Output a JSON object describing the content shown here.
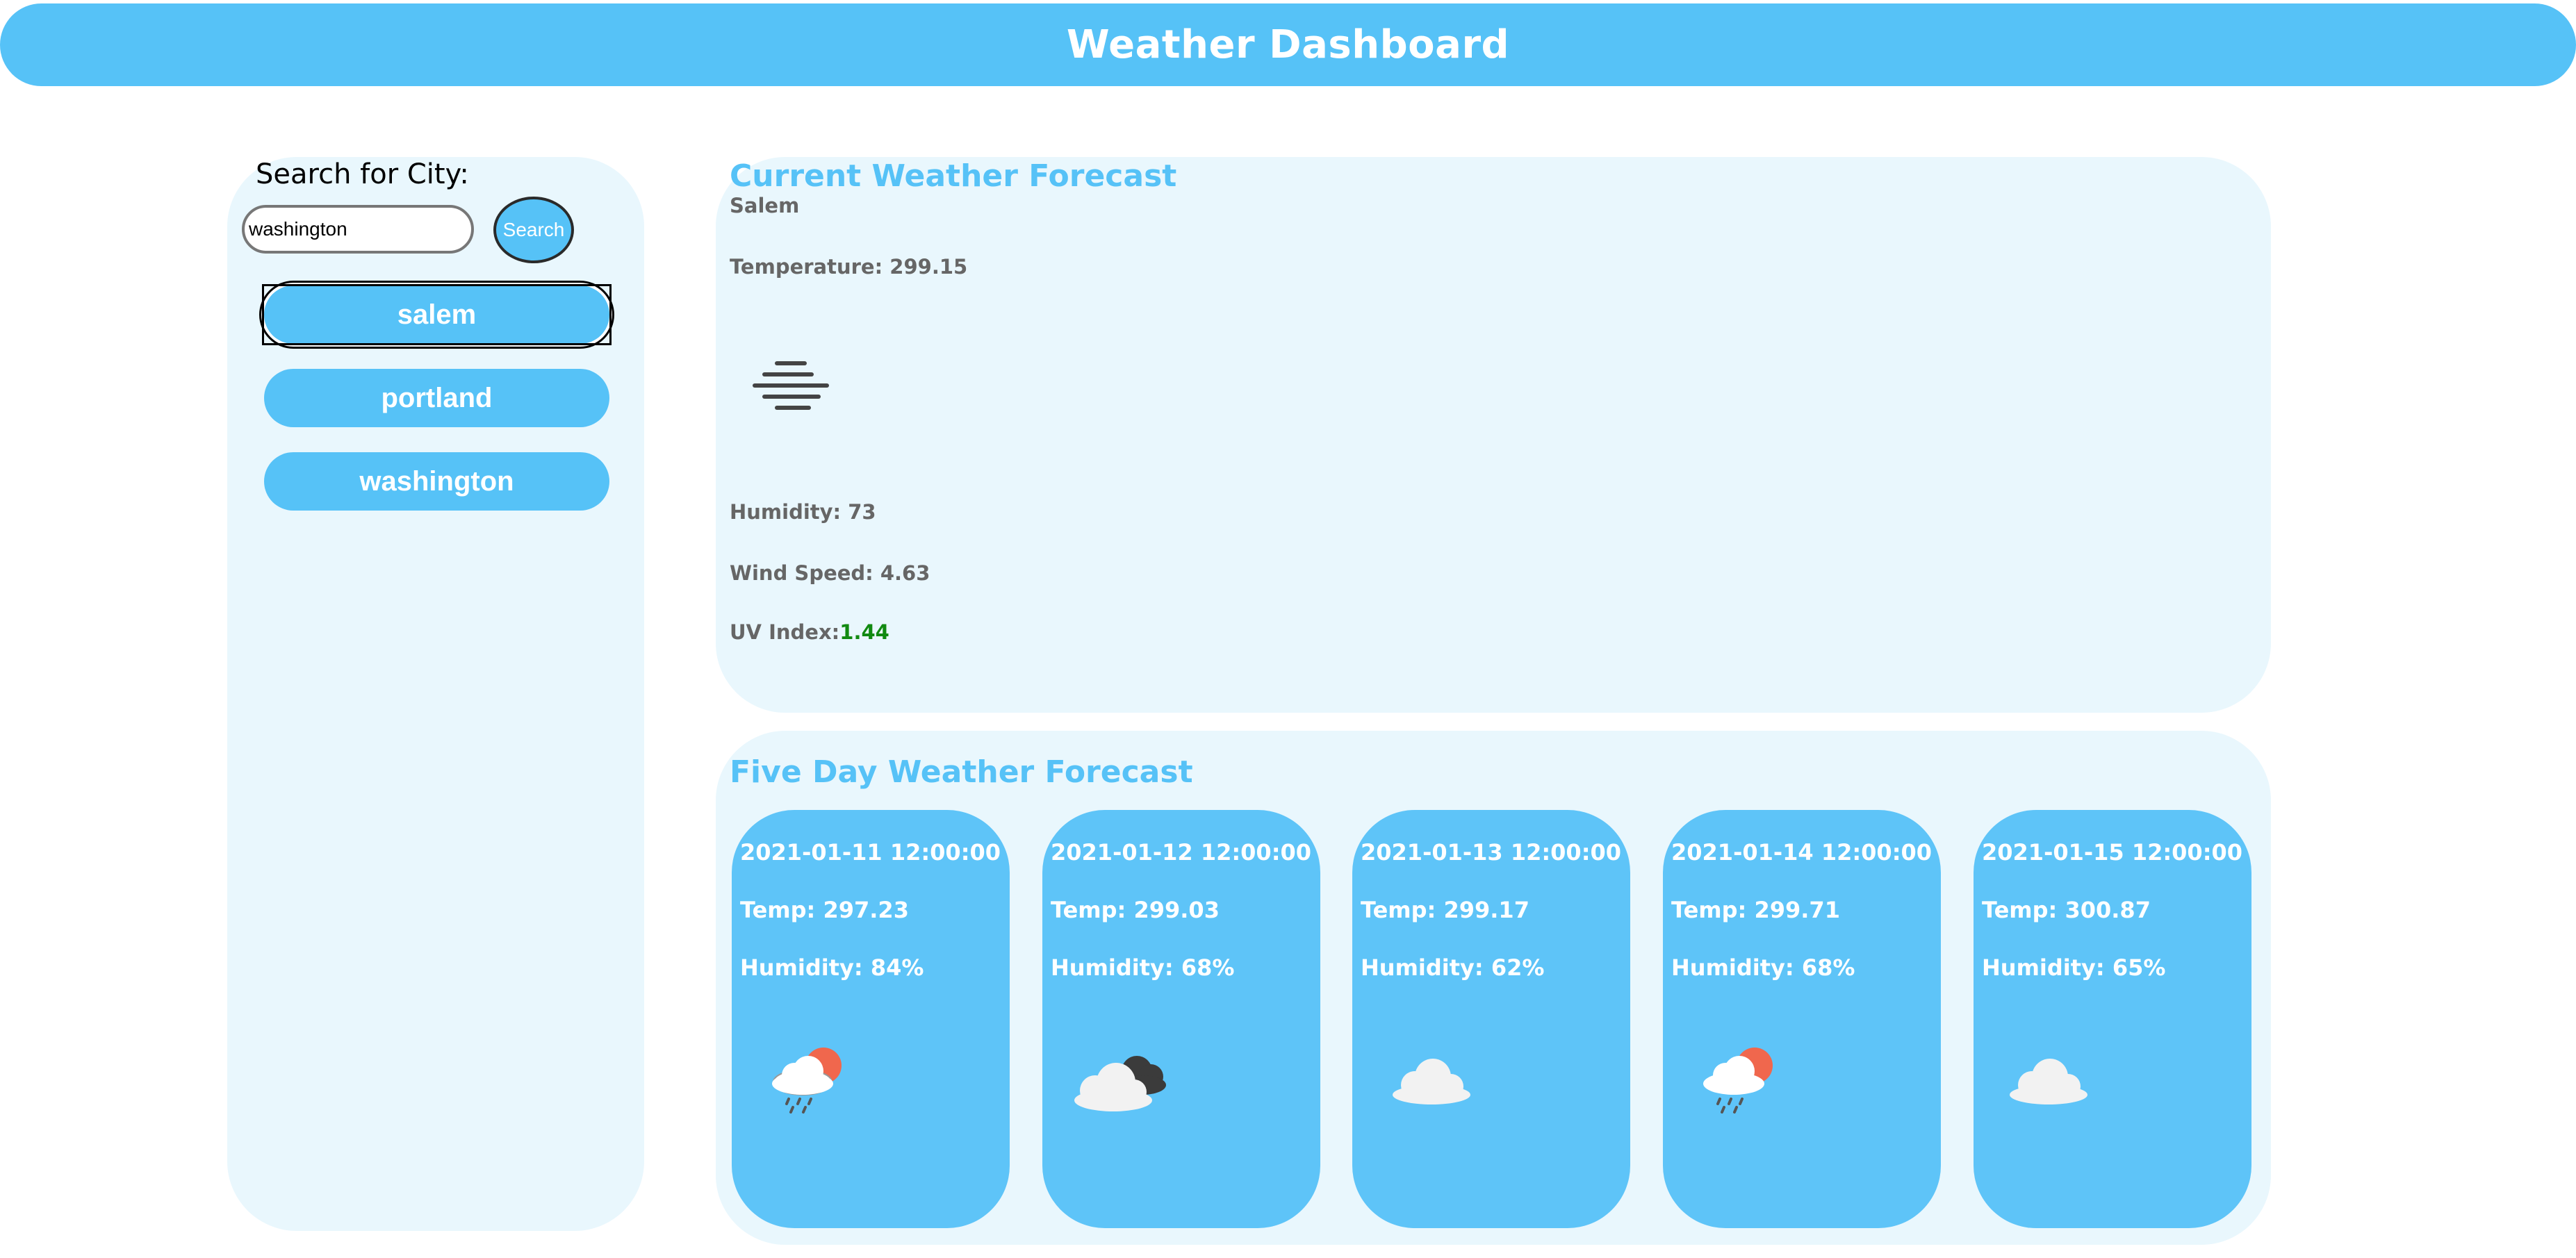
{
  "header": {
    "title": "Weather Dashboard"
  },
  "sidebar": {
    "search_label": "Search for City:",
    "search_value": "washington",
    "search_button": "Search",
    "cities": [
      "salem",
      "portland",
      "washington"
    ],
    "selected_city": "salem"
  },
  "current": {
    "title": "Current Weather Forecast",
    "city": "Salem",
    "temperature_label": "Temperature: 299.15",
    "icon": "mist-icon",
    "humidity_label": "Humidity: 73",
    "wind_label": "Wind Speed: 4.63",
    "uv_label": "UV Index:",
    "uv_value": "1.44",
    "uv_color": "#118a11"
  },
  "forecast": {
    "title": "Five Day Weather Forecast",
    "days": [
      {
        "date": "2021-01-11 12:00:00",
        "temp": "Temp: 297.23",
        "humidity": "Humidity: 84%",
        "icon": "rain-sun-icon"
      },
      {
        "date": "2021-01-12 12:00:00",
        "temp": "Temp: 299.03",
        "humidity": "Humidity: 68%",
        "icon": "broken-clouds-icon"
      },
      {
        "date": "2021-01-13 12:00:00",
        "temp": "Temp: 299.17",
        "humidity": "Humidity: 62%",
        "icon": "cloud-icon"
      },
      {
        "date": "2021-01-14 12:00:00",
        "temp": "Temp: 299.71",
        "humidity": "Humidity: 68%",
        "icon": "rain-sun-icon"
      },
      {
        "date": "2021-01-15 12:00:00",
        "temp": "Temp: 300.87",
        "humidity": "Humidity: 65%",
        "icon": "cloud-icon"
      }
    ]
  },
  "colors": {
    "accent": "#56c2f7",
    "panel": "#e9f7fd",
    "card": "#5ec4f8",
    "sun": "#f0674d"
  }
}
